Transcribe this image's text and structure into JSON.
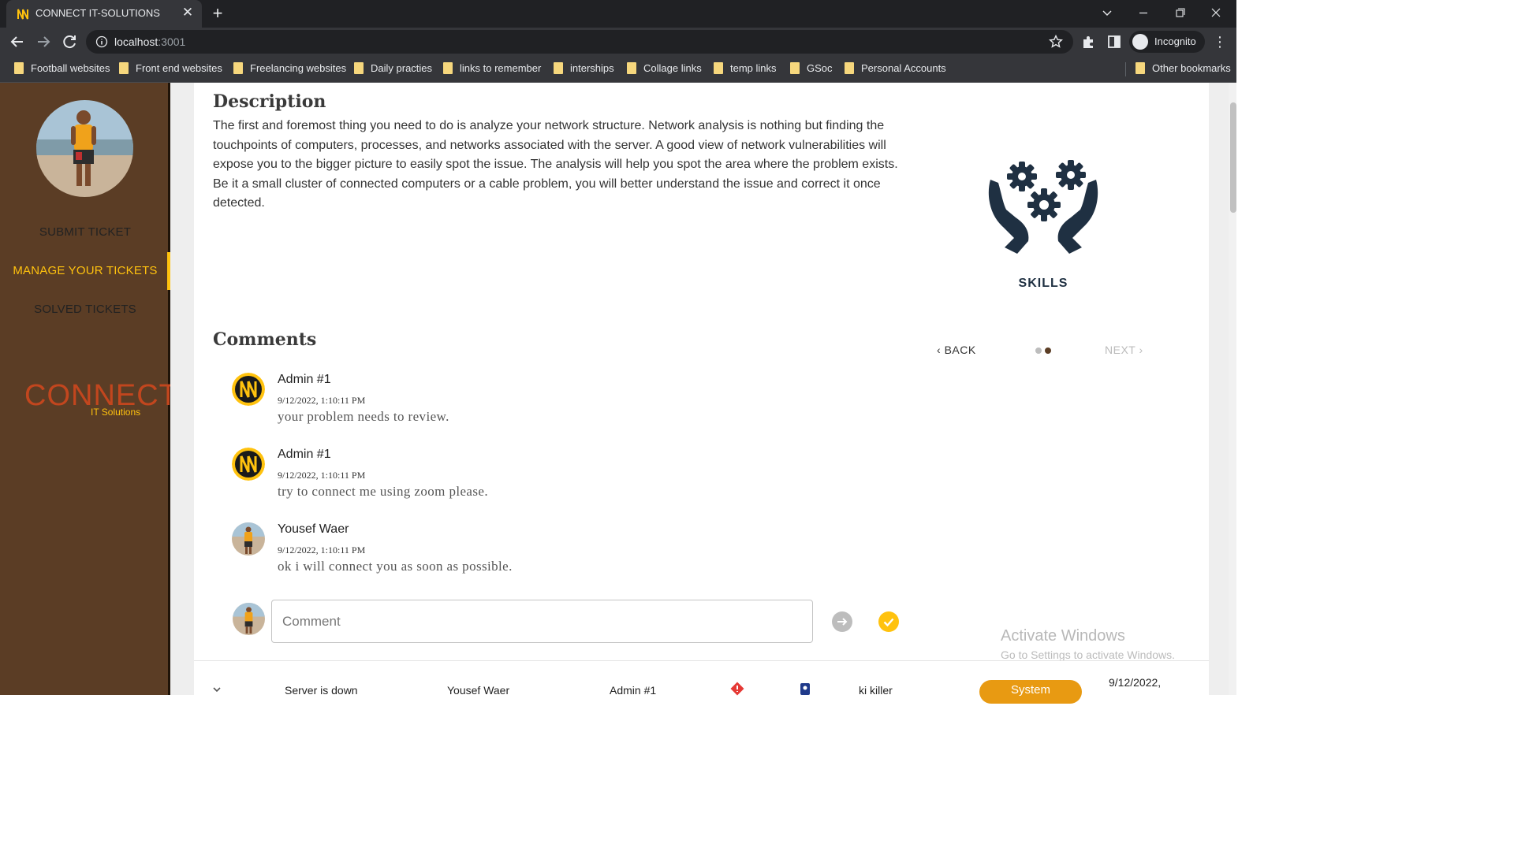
{
  "browser": {
    "tab_title": "CONNECT IT-SOLUTIONS",
    "url_host": "localhost",
    "url_port": ":3001",
    "profile_label": "Incognito",
    "bookmarks": [
      "Football websites",
      "Front end websites",
      "Freelancing websites",
      "Daily practies",
      "links to remember",
      "interships",
      "Collage links",
      "temp links",
      "GSoc",
      "Personal Accounts"
    ],
    "other_bookmarks": "Other bookmarks"
  },
  "sidebar": {
    "nav": [
      {
        "label": "SUBMIT TICKET",
        "active": false
      },
      {
        "label": "MANAGE YOUR TICKETS",
        "active": true
      },
      {
        "label": "SOLVED TICKETS",
        "active": false
      }
    ],
    "logo_word": "CONNECT",
    "logo_sub": "IT Solutions",
    "accent_color": "#ffc20e",
    "background_color": "#5b3d25"
  },
  "ticket": {
    "description_heading": "Description",
    "description": "The first and foremost thing you need to do is analyze your network structure. Network analysis is nothing but finding the touchpoints of computers, processes, and networks associated with the server. A good view of network vulnerabilities will expose you to the bigger picture to easily spot the issue. The analysis will help you spot the area where the problem exists. Be it a small cluster of connected computers or a cable problem, you will better understand the issue and correct it once detected.",
    "category_label": "SKILLS",
    "category_icon": "skills-gears-hands-icon",
    "comments_heading": "Comments",
    "carousel": {
      "back_label": "BACK",
      "next_label": "NEXT",
      "pages": 2,
      "active_page": 2
    },
    "comments": [
      {
        "author": "Admin #1",
        "date": "9/12/2022, 1:10:11 PM",
        "text": "your problem needs to review.",
        "avatar": "connect-logo"
      },
      {
        "author": "Admin #1",
        "date": "9/12/2022, 1:10:11 PM",
        "text": "try to connect me using zoom please.",
        "avatar": "connect-logo"
      },
      {
        "author": "Yousef Waer",
        "date": "9/12/2022, 1:10:11 PM",
        "text": "ok i will connect you as soon as possible.",
        "avatar": "user-photo"
      }
    ],
    "comment_placeholder": "Comment"
  },
  "ticket_row": {
    "title": "Server is down",
    "user": "Yousef Waer",
    "admin": "Admin #1",
    "assignee": "ki killer",
    "type": "System",
    "date": "9/12/2022,"
  },
  "os_watermark": {
    "title": "Activate Windows",
    "subtitle": "Go to Settings to activate Windows."
  }
}
